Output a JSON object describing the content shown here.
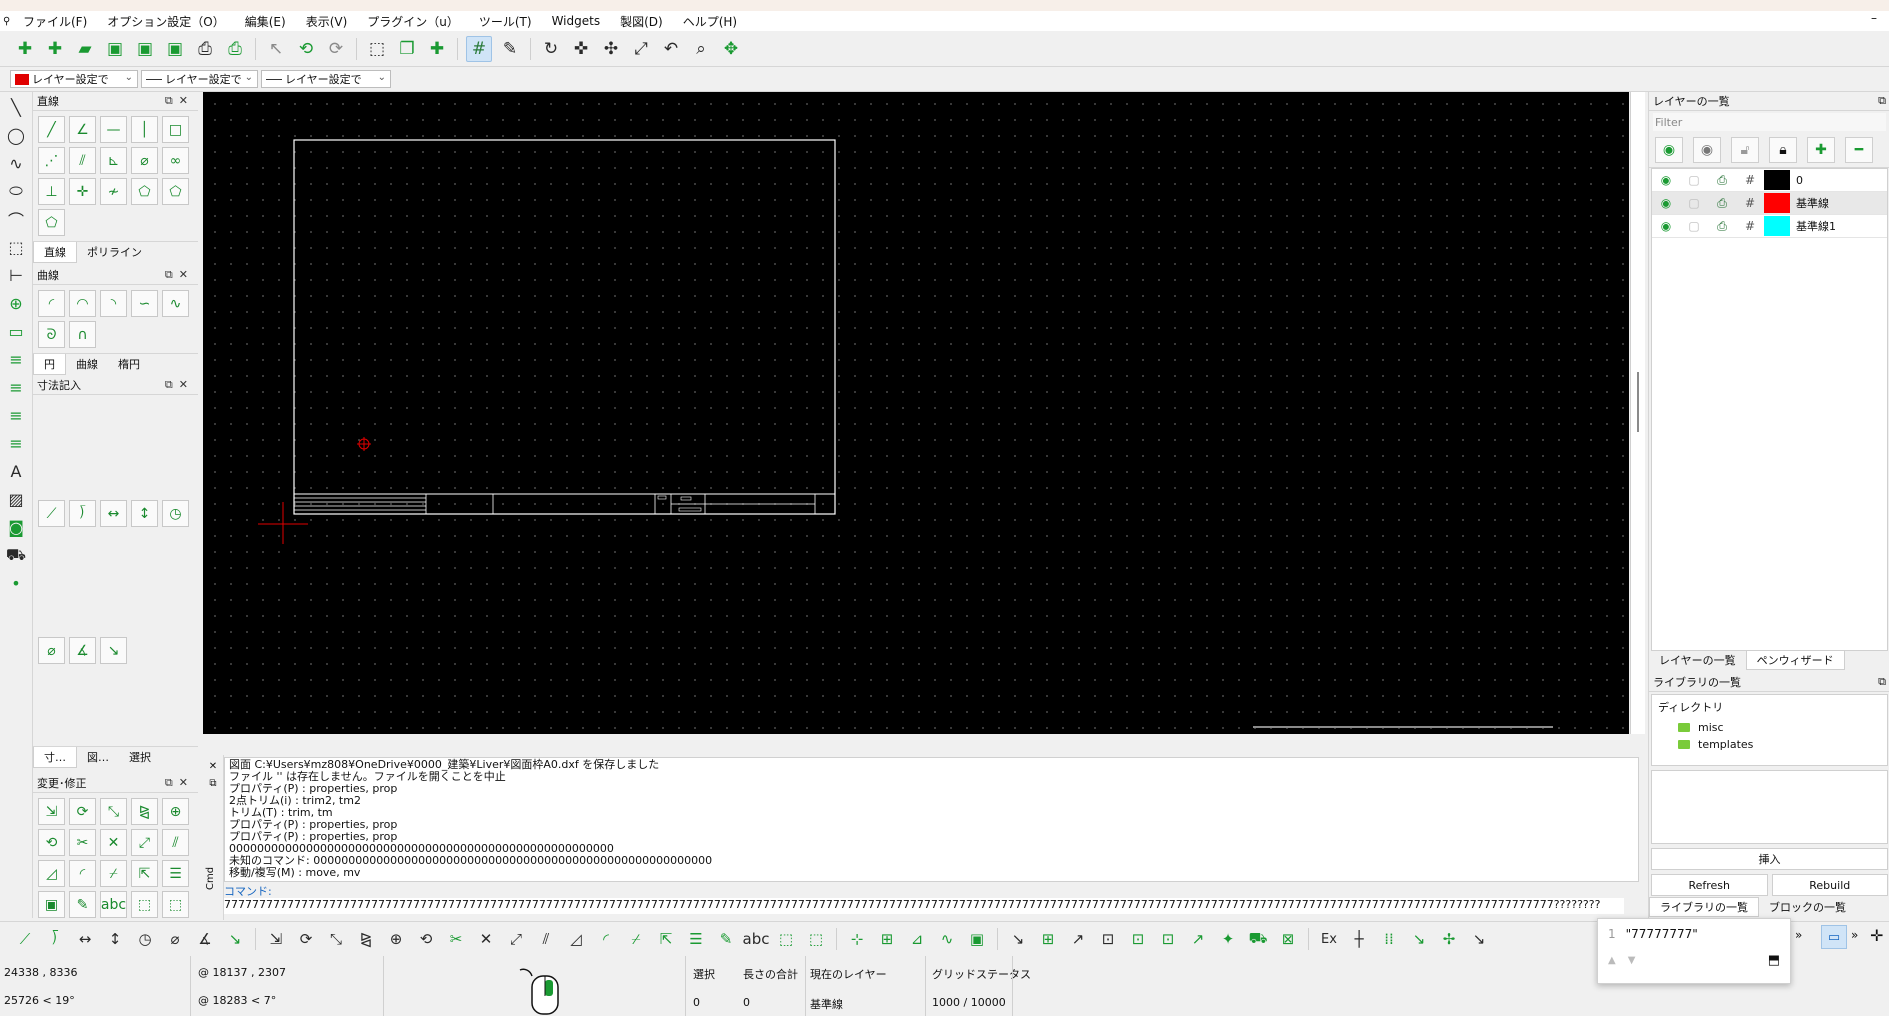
{
  "menu": {
    "items": [
      "ファイル(F)",
      "オプション設定（O）",
      "編集(E)",
      "表示(V)",
      "プラグイン（u）",
      "ツール(T)",
      "Widgets",
      "製図(D)",
      "ヘルプ(H)"
    ],
    "window_min": "–"
  },
  "toolbar2": {
    "color_combo": "レイヤー設定で",
    "width_combo": "レイヤー設定で",
    "type_combo": "レイヤー設定で",
    "accent_color": "#e00000"
  },
  "left_docks": {
    "line": {
      "title": "直線",
      "tabs": [
        "直線",
        "ポリライン"
      ]
    },
    "curve": {
      "title": "曲線",
      "tabs": [
        "円",
        "曲線",
        "楕円"
      ]
    },
    "dimension": {
      "title": "寸法記入"
    },
    "bottom_tabs": [
      "寸…",
      "図…",
      "選択"
    ],
    "modify": {
      "title": "変更･修正"
    }
  },
  "right_panel": {
    "layers_title": "レイヤーの一覧",
    "filter_placeholder": "Filter",
    "layers": [
      {
        "name": "0",
        "color": "#000000"
      },
      {
        "name": "基準線",
        "color": "#ff0000"
      },
      {
        "name": "基準線1",
        "color": "#00ffff"
      }
    ],
    "tabs": [
      "レイヤーの一覧",
      "ペンウィザード"
    ],
    "library_title": "ライブラリの一覧",
    "library": {
      "header": "ディレクトリ",
      "folders": [
        "misc",
        "templates"
      ]
    },
    "insert_button": "挿入",
    "refresh_button": "Refresh",
    "rebuild_button": "Rebuild",
    "bottom_tabs": [
      "ライブラリの一覧",
      "ブロックの一覧"
    ]
  },
  "command": {
    "side_label": "Cmd",
    "log": [
      "図面 C:¥Users¥mz808¥OneDrive¥0000_建築¥Liver¥図面枠A0.dxf を保存しました",
      "ファイル '' は存在しません。ファイルを開くことを中止",
      "プロパティ(P) : properties, prop",
      "2点トリム(i) : trim2, tm2",
      "トリム(T) : trim, tm",
      "プロパティ(P) : properties, prop",
      "プロパティ(P) : properties, prop",
      "0000000000000000000000000000000000000000000000000000000",
      "未知のコマンド: 000000000000000000000000000000000000000000000000000000000",
      "移動/複写(M) : move, mv"
    ],
    "label": "コマンド:",
    "input_value": "7777777777777777777777777777777777777777777777777777777777777777777777777777777777777777777777777777777777777777777777777777777777777777777777777777777777777777777777777777777777777777777777????????"
  },
  "status": {
    "abs_coord": "24338 , 8336",
    "abs_polar": "25726 < 19°",
    "rel_coord": "@  18137 , 2307",
    "rel_polar": "@  18283 < 7°",
    "selection_label": "選択",
    "selection_value": "0",
    "length_label": "長さの合計",
    "length_value": "0",
    "layer_label": "現在のレイヤー",
    "layer_value": "基準線",
    "grid_label": "グリッドステータス",
    "grid_value": "1000 / 10000"
  },
  "popup": {
    "index": "1",
    "value": "\"77777777\""
  },
  "bottom_ex": "Ex"
}
